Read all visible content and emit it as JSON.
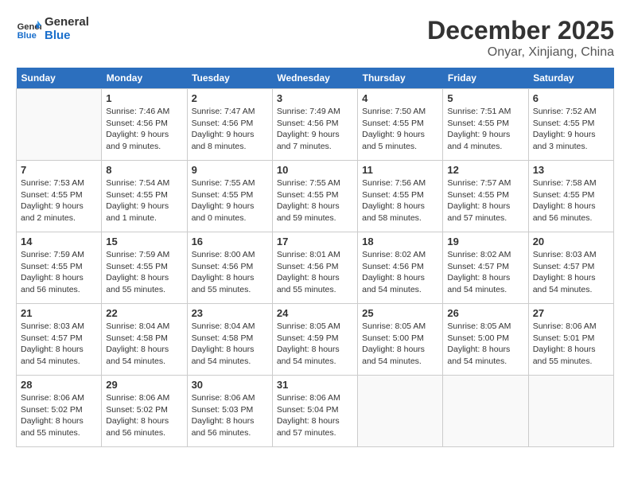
{
  "header": {
    "logo_line1": "General",
    "logo_line2": "Blue",
    "month": "December 2025",
    "location": "Onyar, Xinjiang, China"
  },
  "weekdays": [
    "Sunday",
    "Monday",
    "Tuesday",
    "Wednesday",
    "Thursday",
    "Friday",
    "Saturday"
  ],
  "weeks": [
    [
      {
        "day": "",
        "info": ""
      },
      {
        "day": "1",
        "info": "Sunrise: 7:46 AM\nSunset: 4:56 PM\nDaylight: 9 hours\nand 9 minutes."
      },
      {
        "day": "2",
        "info": "Sunrise: 7:47 AM\nSunset: 4:56 PM\nDaylight: 9 hours\nand 8 minutes."
      },
      {
        "day": "3",
        "info": "Sunrise: 7:49 AM\nSunset: 4:56 PM\nDaylight: 9 hours\nand 7 minutes."
      },
      {
        "day": "4",
        "info": "Sunrise: 7:50 AM\nSunset: 4:55 PM\nDaylight: 9 hours\nand 5 minutes."
      },
      {
        "day": "5",
        "info": "Sunrise: 7:51 AM\nSunset: 4:55 PM\nDaylight: 9 hours\nand 4 minutes."
      },
      {
        "day": "6",
        "info": "Sunrise: 7:52 AM\nSunset: 4:55 PM\nDaylight: 9 hours\nand 3 minutes."
      }
    ],
    [
      {
        "day": "7",
        "info": "Sunrise: 7:53 AM\nSunset: 4:55 PM\nDaylight: 9 hours\nand 2 minutes."
      },
      {
        "day": "8",
        "info": "Sunrise: 7:54 AM\nSunset: 4:55 PM\nDaylight: 9 hours\nand 1 minute."
      },
      {
        "day": "9",
        "info": "Sunrise: 7:55 AM\nSunset: 4:55 PM\nDaylight: 9 hours\nand 0 minutes."
      },
      {
        "day": "10",
        "info": "Sunrise: 7:55 AM\nSunset: 4:55 PM\nDaylight: 8 hours\nand 59 minutes."
      },
      {
        "day": "11",
        "info": "Sunrise: 7:56 AM\nSunset: 4:55 PM\nDaylight: 8 hours\nand 58 minutes."
      },
      {
        "day": "12",
        "info": "Sunrise: 7:57 AM\nSunset: 4:55 PM\nDaylight: 8 hours\nand 57 minutes."
      },
      {
        "day": "13",
        "info": "Sunrise: 7:58 AM\nSunset: 4:55 PM\nDaylight: 8 hours\nand 56 minutes."
      }
    ],
    [
      {
        "day": "14",
        "info": "Sunrise: 7:59 AM\nSunset: 4:55 PM\nDaylight: 8 hours\nand 56 minutes."
      },
      {
        "day": "15",
        "info": "Sunrise: 7:59 AM\nSunset: 4:55 PM\nDaylight: 8 hours\nand 55 minutes."
      },
      {
        "day": "16",
        "info": "Sunrise: 8:00 AM\nSunset: 4:56 PM\nDaylight: 8 hours\nand 55 minutes."
      },
      {
        "day": "17",
        "info": "Sunrise: 8:01 AM\nSunset: 4:56 PM\nDaylight: 8 hours\nand 55 minutes."
      },
      {
        "day": "18",
        "info": "Sunrise: 8:02 AM\nSunset: 4:56 PM\nDaylight: 8 hours\nand 54 minutes."
      },
      {
        "day": "19",
        "info": "Sunrise: 8:02 AM\nSunset: 4:57 PM\nDaylight: 8 hours\nand 54 minutes."
      },
      {
        "day": "20",
        "info": "Sunrise: 8:03 AM\nSunset: 4:57 PM\nDaylight: 8 hours\nand 54 minutes."
      }
    ],
    [
      {
        "day": "21",
        "info": "Sunrise: 8:03 AM\nSunset: 4:57 PM\nDaylight: 8 hours\nand 54 minutes."
      },
      {
        "day": "22",
        "info": "Sunrise: 8:04 AM\nSunset: 4:58 PM\nDaylight: 8 hours\nand 54 minutes."
      },
      {
        "day": "23",
        "info": "Sunrise: 8:04 AM\nSunset: 4:58 PM\nDaylight: 8 hours\nand 54 minutes."
      },
      {
        "day": "24",
        "info": "Sunrise: 8:05 AM\nSunset: 4:59 PM\nDaylight: 8 hours\nand 54 minutes."
      },
      {
        "day": "25",
        "info": "Sunrise: 8:05 AM\nSunset: 5:00 PM\nDaylight: 8 hours\nand 54 minutes."
      },
      {
        "day": "26",
        "info": "Sunrise: 8:05 AM\nSunset: 5:00 PM\nDaylight: 8 hours\nand 54 minutes."
      },
      {
        "day": "27",
        "info": "Sunrise: 8:06 AM\nSunset: 5:01 PM\nDaylight: 8 hours\nand 55 minutes."
      }
    ],
    [
      {
        "day": "28",
        "info": "Sunrise: 8:06 AM\nSunset: 5:02 PM\nDaylight: 8 hours\nand 55 minutes."
      },
      {
        "day": "29",
        "info": "Sunrise: 8:06 AM\nSunset: 5:02 PM\nDaylight: 8 hours\nand 56 minutes."
      },
      {
        "day": "30",
        "info": "Sunrise: 8:06 AM\nSunset: 5:03 PM\nDaylight: 8 hours\nand 56 minutes."
      },
      {
        "day": "31",
        "info": "Sunrise: 8:06 AM\nSunset: 5:04 PM\nDaylight: 8 hours\nand 57 minutes."
      },
      {
        "day": "",
        "info": ""
      },
      {
        "day": "",
        "info": ""
      },
      {
        "day": "",
        "info": ""
      }
    ]
  ]
}
